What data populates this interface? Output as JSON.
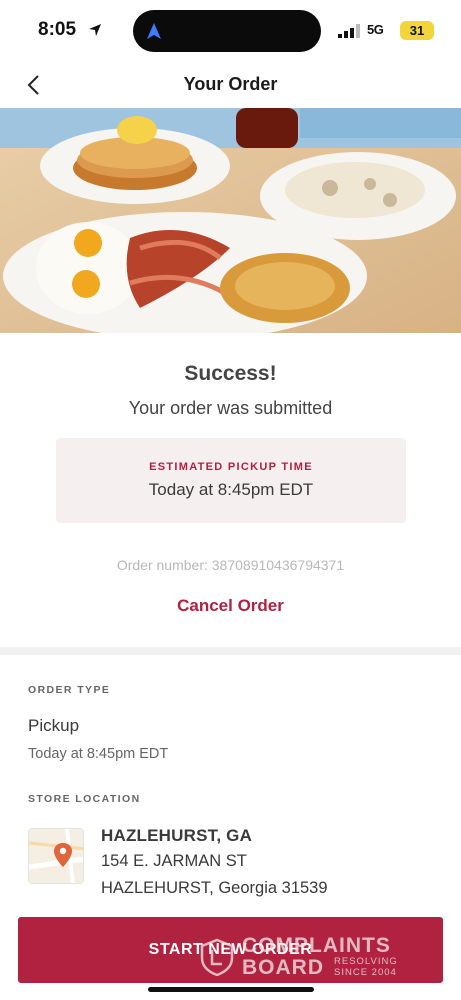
{
  "status_bar": {
    "time": "8:05",
    "network": "5G",
    "battery": "31"
  },
  "header": {
    "title": "Your Order",
    "back_icon": "chevron-left-icon"
  },
  "hero": {
    "image": "breakfast-plates-photo"
  },
  "success": {
    "title": "Success!",
    "subtitle": "Your order was submitted"
  },
  "pickup": {
    "label": "ESTIMATED PICKUP TIME",
    "time": "Today at 8:45pm EDT"
  },
  "order": {
    "number_text": "Order number: 38708910436794371",
    "cancel_label": "Cancel Order"
  },
  "order_type": {
    "label": "ORDER TYPE",
    "value": "Pickup",
    "time": "Today at 8:45pm EDT"
  },
  "store": {
    "label": "STORE LOCATION",
    "name": "HAZLEHURST, GA",
    "street": "154 E. JARMAN ST",
    "city": "HAZLEHURST, Georgia 31539",
    "map_icon": "map-pin-icon"
  },
  "cta": {
    "label": "START NEW ORDER"
  },
  "watermark": {
    "line1": "COMPLAINTS",
    "line2": "BOARD",
    "small1": "RESOLVING",
    "small2": "SINCE 2004"
  },
  "colors": {
    "accent": "#b0223f",
    "pickup_bg": "#f5eff0"
  }
}
